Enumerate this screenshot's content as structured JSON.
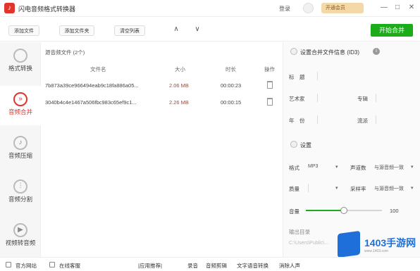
{
  "window": {
    "title": "闪电音频格式转换器",
    "login_label": "登录",
    "vip_label": "开通会员",
    "min_glyph": "—",
    "max_glyph": "□",
    "close_glyph": "✕"
  },
  "toolbar": {
    "add_file": "添加文件",
    "add_folder": "添加文件夹",
    "clear_list": "清空列表",
    "up_glyph": "∧",
    "down_glyph": "∨",
    "start_merge": "开始合并"
  },
  "sidebar": {
    "items": [
      {
        "label": "格式转换",
        "icon": "format-convert-icon",
        "glyph": ""
      },
      {
        "label": "音频合并",
        "icon": "merge-icon",
        "glyph": "»"
      },
      {
        "label": "音频压缩",
        "icon": "compress-icon",
        "glyph": "♪"
      },
      {
        "label": "音频分割",
        "icon": "split-icon",
        "glyph": "⫶"
      },
      {
        "label": "视频转音频",
        "icon": "video-to-audio-icon",
        "glyph": "▶"
      }
    ]
  },
  "filelist": {
    "title": "源音频文件 (2个)",
    "headers": {
      "name": "文件名",
      "size": "大小",
      "duration": "时长",
      "action": "操作"
    },
    "rows": [
      {
        "name": "7b873a39ce966494eab9c18fa886a05...",
        "size": "2.06 MB",
        "duration": "00:00:23"
      },
      {
        "name": "3040b4c4e1467a506fbc983c65ef9c1...",
        "size": "2.26 MB",
        "duration": "00:00:15"
      }
    ]
  },
  "settings": {
    "merged_info_title": "设置合并文件信息 (ID3)",
    "info_glyph": "i",
    "title_label": "标　题",
    "artist_label": "艺术家",
    "album_label": "专辑",
    "year_label": "年　份",
    "genre_label": "流派",
    "settings_title": "设置",
    "format_label": "格式",
    "format_value": "MP3",
    "channels_label": "声道数",
    "channels_value": "与源音频一致",
    "quality_label": "质量",
    "samplerate_label": "采样率",
    "samplerate_value": "与源音频一致",
    "volume_label": "音量",
    "volume_value": "100",
    "volume_level": 0.5,
    "output_label": "输出目录",
    "output_path": "C:\\Users\\Public\\..."
  },
  "statusbar": {
    "website": "官方网站",
    "contact": "在线客服",
    "recommend": "|应用推荐|",
    "record": "录音",
    "audio_edit": "音频剪辑",
    "tts": "文字语音转换",
    "vocal_remove": "消除人声"
  },
  "watermark": {
    "brand": "1403手游网",
    "sub": "www.1403.com"
  },
  "colors": {
    "accent_green": "#1aad19",
    "accent_red": "#e0342c",
    "vip_gold": "#f4d9a8"
  }
}
